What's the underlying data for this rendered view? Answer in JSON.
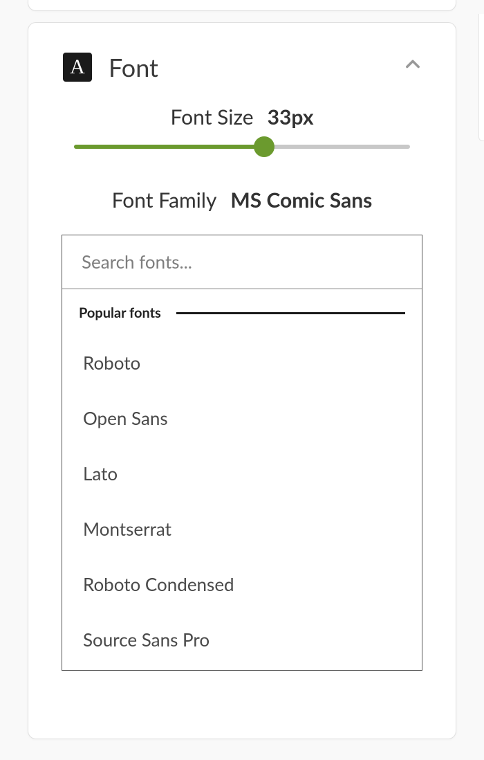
{
  "panel": {
    "icon_glyph": "A",
    "title": "Font",
    "font_size_label": "Font Size",
    "font_size_value": "33px",
    "font_family_label": "Font Family",
    "font_family_value": "MS Comic Sans",
    "slider_percent": 56.5,
    "colors": {
      "accent": "#6b9a2e"
    }
  },
  "picker": {
    "search_placeholder": "Search fonts...",
    "section_label": "Popular fonts",
    "fonts": [
      "Roboto",
      "Open Sans",
      "Lato",
      "Montserrat",
      "Roboto Condensed",
      "Source Sans Pro"
    ]
  }
}
